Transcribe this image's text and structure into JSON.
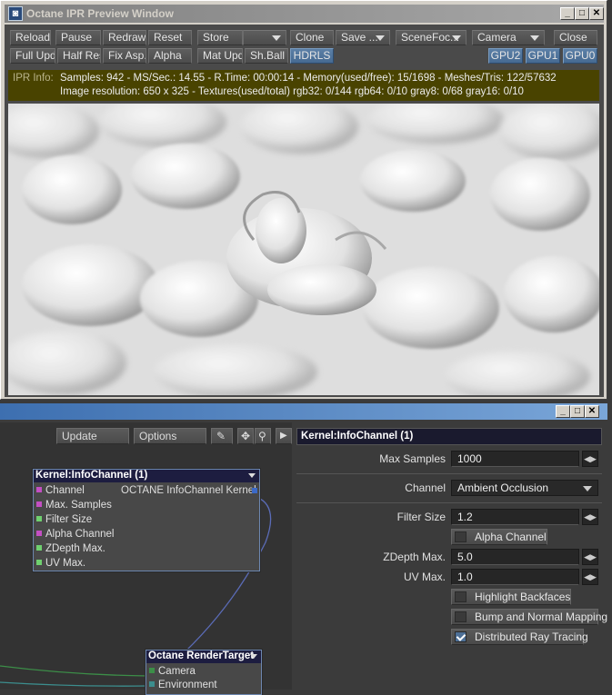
{
  "ipr": {
    "title": "Octane IPR Preview Window",
    "toolbar_row1": [
      "Reload",
      "Pause",
      "Redraw",
      "Reset",
      "Store",
      "",
      "Clone",
      "Save ...",
      "SceneFoc...",
      "Camera",
      "Close"
    ],
    "toolbar_row2": [
      "Full Upd.",
      "Half Res",
      "Fix Asp.",
      "Alpha",
      "Mat Upd",
      "Sh.Ball",
      "HDRLS"
    ],
    "gpu_buttons": [
      "GPU2",
      "GPU1",
      "GPU0"
    ],
    "info_label": "IPR Info:",
    "info_line1": "Samples: 942  -  MS/Sec.: 14.55  -  R.Time: 00:00:14 - Memory(used/free): 15/1698  -  Meshes/Tris: 122/57632",
    "info_line2": "Image resolution: 650 x 325 - Textures(used/total) rgb32: 0/144   rgb64: 0/10   gray8: 0/68   gray16: 0/10"
  },
  "node_editor": {
    "update_label": "Update",
    "options_label": "Options",
    "node_infochannel": {
      "title": "Kernel:InfoChannel (1)",
      "output_label": "OCTANE InfoChannel Kernel",
      "inputs": [
        "Channel",
        "Max. Samples",
        "Filter Size",
        "Alpha Channel",
        "ZDepth Max.",
        "UV Max."
      ]
    },
    "node_rendertarget": {
      "title": "Octane RenderTarget",
      "inputs": [
        "Camera",
        "Environment"
      ]
    },
    "properties": {
      "header": "Kernel:InfoChannel (1)",
      "max_samples_label": "Max Samples",
      "max_samples_value": "1000",
      "channel_label": "Channel",
      "channel_value": "Ambient Occlusion",
      "filter_size_label": "Filter Size",
      "filter_size_value": "1.2",
      "alpha_channel_label": "Alpha Channel",
      "zdepth_label": "ZDepth Max.",
      "zdepth_value": "5.0",
      "uv_label": "UV Max.",
      "uv_value": "1.0",
      "highlight_backfaces_label": "Highlight Backfaces",
      "bump_normal_label": "Bump and Normal Mapping",
      "distributed_ray_label": "Distributed Ray Tracing",
      "distributed_ray_checked": true
    }
  }
}
